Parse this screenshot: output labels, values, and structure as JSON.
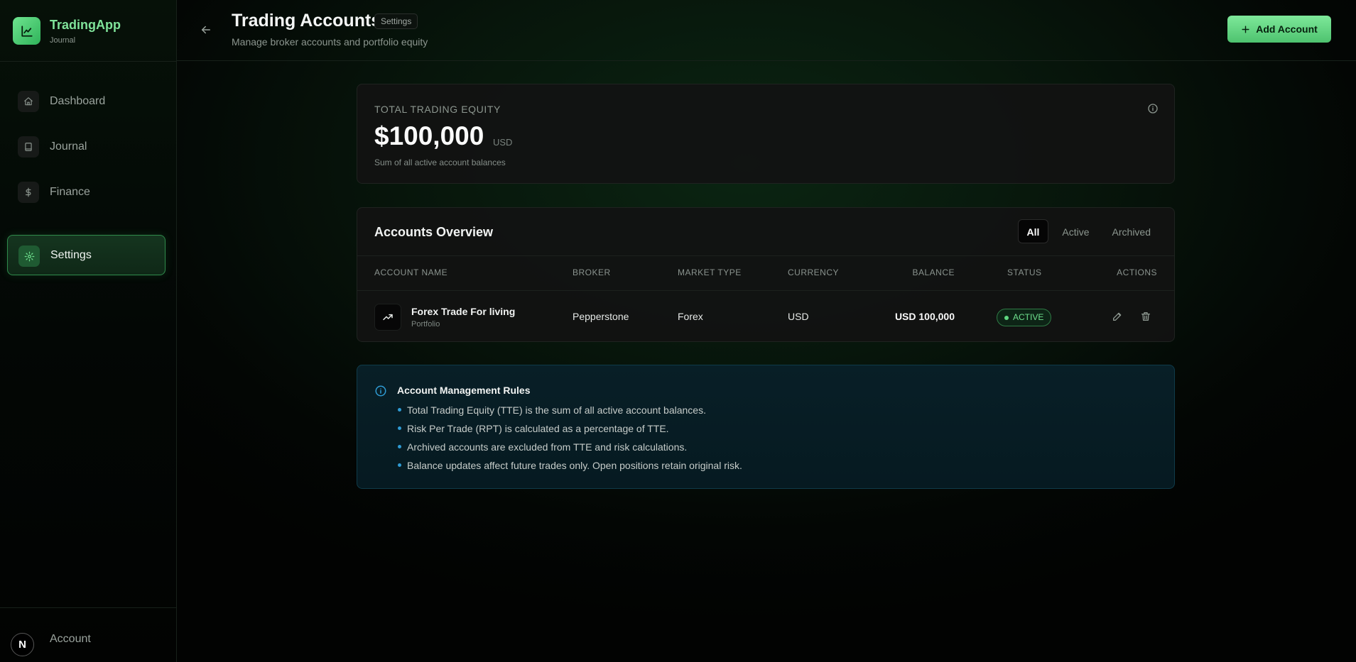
{
  "brand": {
    "name": "TradingApp",
    "subtitle": "Journal"
  },
  "sidebar": {
    "items": [
      {
        "label": "Dashboard",
        "icon": "home-icon",
        "active": false
      },
      {
        "label": "Journal",
        "icon": "book-icon",
        "active": false
      },
      {
        "label": "Finance",
        "icon": "dollar-icon",
        "active": false
      },
      {
        "label": "Settings",
        "icon": "gear-icon",
        "active": true
      }
    ],
    "account": {
      "avatar": "N",
      "label": "Account"
    }
  },
  "header": {
    "title": "Trading Accounts",
    "badge": "Settings",
    "subtitle": "Manage broker accounts and portfolio equity",
    "add_button": "Add Account"
  },
  "equity": {
    "label": "TOTAL TRADING EQUITY",
    "value": "$100,000",
    "currency": "USD",
    "note": "Sum of all active account balances"
  },
  "accounts": {
    "title": "Accounts Overview",
    "filters": [
      {
        "label": "All",
        "active": true
      },
      {
        "label": "Active",
        "active": false
      },
      {
        "label": "Archived",
        "active": false
      }
    ],
    "columns": [
      "ACCOUNT NAME",
      "BROKER",
      "MARKET TYPE",
      "CURRENCY",
      "BALANCE",
      "STATUS",
      "ACTIONS"
    ],
    "rows": [
      {
        "name": "Forex Trade For living",
        "type": "Portfolio",
        "broker": "Pepperstone",
        "market": "Forex",
        "currency": "USD",
        "balance": "USD 100,000",
        "status": "ACTIVE"
      }
    ]
  },
  "rules": {
    "title": "Account Management Rules",
    "items": [
      "Total Trading Equity (TTE) is the sum of all active account balances.",
      "Risk Per Trade (RPT) is calculated as a percentage of TTE.",
      "Archived accounts are excluded from TTE and risk calculations.",
      "Balance updates affect future trades only. Open positions retain original risk."
    ]
  },
  "colors": {
    "accent": "#5fd880",
    "info": "#2f9bd4"
  }
}
